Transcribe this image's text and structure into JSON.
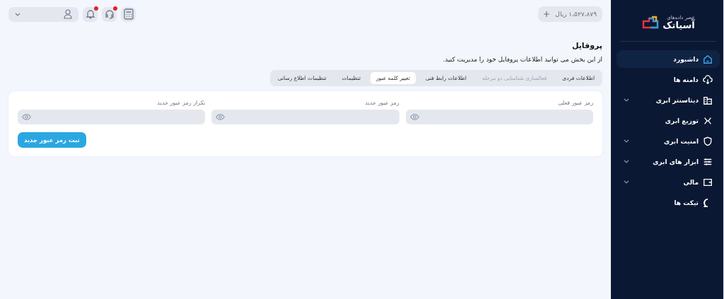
{
  "sidebar": {
    "logo": {
      "name": "آسیاتک",
      "tagline": "عصر داده‌های"
    },
    "items": [
      {
        "label": "داشبورد",
        "selected": true,
        "expandable": false
      },
      {
        "label": "دامنه ها",
        "selected": false,
        "expandable": false
      },
      {
        "label": "دیتاسنتر ابری",
        "selected": false,
        "expandable": true
      },
      {
        "label": "توزیع ابری",
        "selected": false,
        "expandable": false
      },
      {
        "label": "امنیت ابری",
        "selected": false,
        "expandable": true
      },
      {
        "label": "ابزار های ابری",
        "selected": false,
        "expandable": true
      },
      {
        "label": "مالی",
        "selected": false,
        "expandable": true
      },
      {
        "label": "تیکت ها",
        "selected": false,
        "expandable": false
      }
    ]
  },
  "header": {
    "balance": "۱،۵۲۷،۸۷۹ ریال",
    "notifications_badge": true,
    "support_badge": true
  },
  "page": {
    "title": "پروفایل",
    "description": "از این بخش می توانید اطلاعات پروفایل خود را مدیریت کنید."
  },
  "tabs": [
    {
      "label": "اطلاعات فردی",
      "selected": false,
      "disabled": false
    },
    {
      "label": "فعالسازی شناسایی دو مرحله",
      "selected": false,
      "disabled": true
    },
    {
      "label": "اطلاعات رابط فنی",
      "selected": false,
      "disabled": false
    },
    {
      "label": "تغییر کلمه عبور",
      "selected": true,
      "disabled": false
    },
    {
      "label": "تنظیمات",
      "selected": false,
      "disabled": false
    },
    {
      "label": "تنظیمات اطلاع رسانی",
      "selected": false,
      "disabled": false
    }
  ],
  "form": {
    "fields": [
      {
        "label": "رمز عبور فعلی"
      },
      {
        "label": "رمز عبور جدید"
      },
      {
        "label": "تکرار رمز عبور جدید"
      }
    ],
    "submit": "ثبت رمز عبور جدید"
  }
}
